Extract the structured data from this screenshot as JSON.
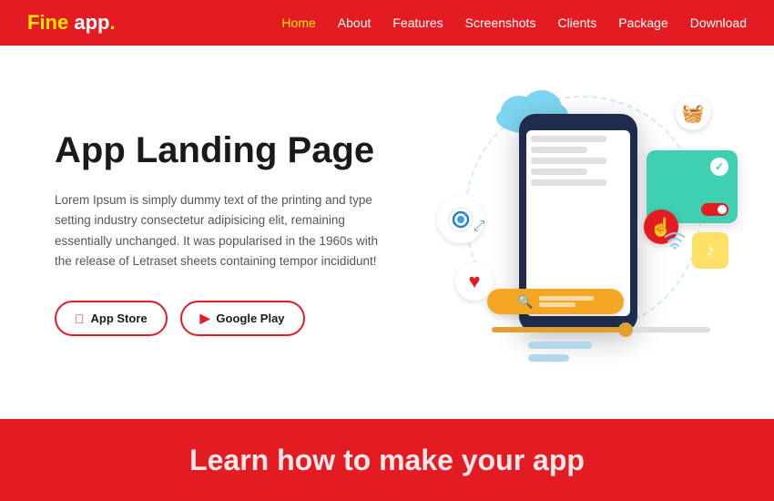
{
  "header": {
    "logo": {
      "fine": "Fine",
      "app": " app",
      "dot": "."
    },
    "nav": [
      {
        "label": "Home",
        "active": true
      },
      {
        "label": "About",
        "active": false
      },
      {
        "label": "Features",
        "active": false
      },
      {
        "label": "Screenshots",
        "active": false
      },
      {
        "label": "Clients",
        "active": false
      },
      {
        "label": "Package",
        "active": false
      },
      {
        "label": "Download",
        "active": false
      }
    ]
  },
  "hero": {
    "title": "App Landing Page",
    "description": "Lorem Ipsum is simply dummy text of the printing and type setting industry consectetur adipisicing elit, remaining essentially unchanged. It was popularised in the 1960s with the release of Letraset sheets containing tempor incididunt!",
    "btn_appstore": "App Store",
    "btn_googleplay": "Google Play"
  },
  "bottom": {
    "title": "Learn how to make your app"
  }
}
